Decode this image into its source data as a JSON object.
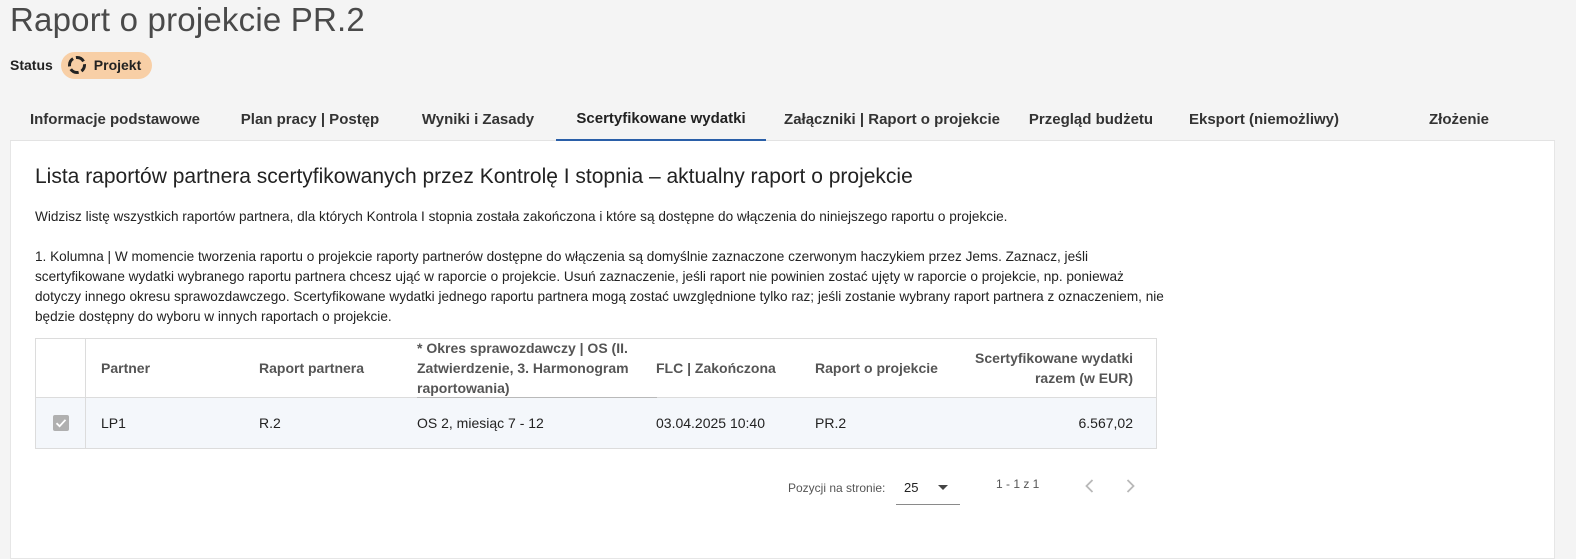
{
  "page": {
    "title": "Raport o projekcie PR.2"
  },
  "status": {
    "label": "Status",
    "value": "Projekt",
    "badge_color": "#f8cfa6",
    "icon": "spinner-icon"
  },
  "tabs": [
    {
      "label": "Informacje podstawowe",
      "active": false
    },
    {
      "label": "Plan pracy | Postęp",
      "active": false
    },
    {
      "label": "Wyniki i Zasady",
      "active": false
    },
    {
      "label": "Scertyfikowane wydatki",
      "active": true
    },
    {
      "label": "Załączniki | Raport o projekcie",
      "active": false
    },
    {
      "label": "Przegląd budżetu",
      "active": false
    },
    {
      "label": "Eksport (niemożliwy)",
      "active": false
    },
    {
      "label": "Złożenie",
      "active": false
    }
  ],
  "section": {
    "title": "Lista raportów partnera scertyfikowanych przez Kontrolę I stopnia – aktualny raport o projekcie",
    "description1": "Widzisz listę wszystkich raportów partnera, dla których Kontrola I stopnia została zakończona i które są dostępne do włączenia do niniejszego raportu o projekcie.",
    "description2": "1. Kolumna | W momencie tworzenia raportu o projekcie raporty partnerów dostępne do włączenia są domyślnie zaznaczone czerwonym haczykiem przez Jems. Zaznacz, jeśli scertyfikowane wydatki wybranego raportu partnera chcesz ująć w raporcie o projekcie. Usuń zaznaczenie, jeśli raport nie powinien zostać ujęty w raporcie o projekcie, np. ponieważ dotyczy innego okresu sprawozdawczego. Scertyfikowane wydatki jednego raportu partnera mogą zostać uwzględnione tylko raz; jeśli zostanie wybrany raport partnera z oznaczeniem, nie będzie dostępny do wyboru w innych raportach o projekcie."
  },
  "table": {
    "headers": {
      "partner": "Partner",
      "report": "Raport partnera",
      "period": "* Okres sprawozdawczy | OS (II. Zatwierdzenie, 3. Harmonogram raportowania)",
      "flc": "FLC | Zakończona",
      "project_report": "Raport o projekcie",
      "total": "Scertyfikowane wydatki razem (w EUR)"
    },
    "rows": [
      {
        "selected": true,
        "partner": "LP1",
        "report": "R.2",
        "period": "OS 2, miesiąc 7 - 12",
        "flc": "03.04.2025 10:40",
        "project_report": "PR.2",
        "total": "6.567,02"
      }
    ]
  },
  "paginator": {
    "label": "Pozycji na stronie:",
    "page_size": "25",
    "range": "1 - 1 z 1"
  },
  "colors": {
    "accent": "#2a5fa8",
    "row_bg": "#f4f7fb"
  }
}
